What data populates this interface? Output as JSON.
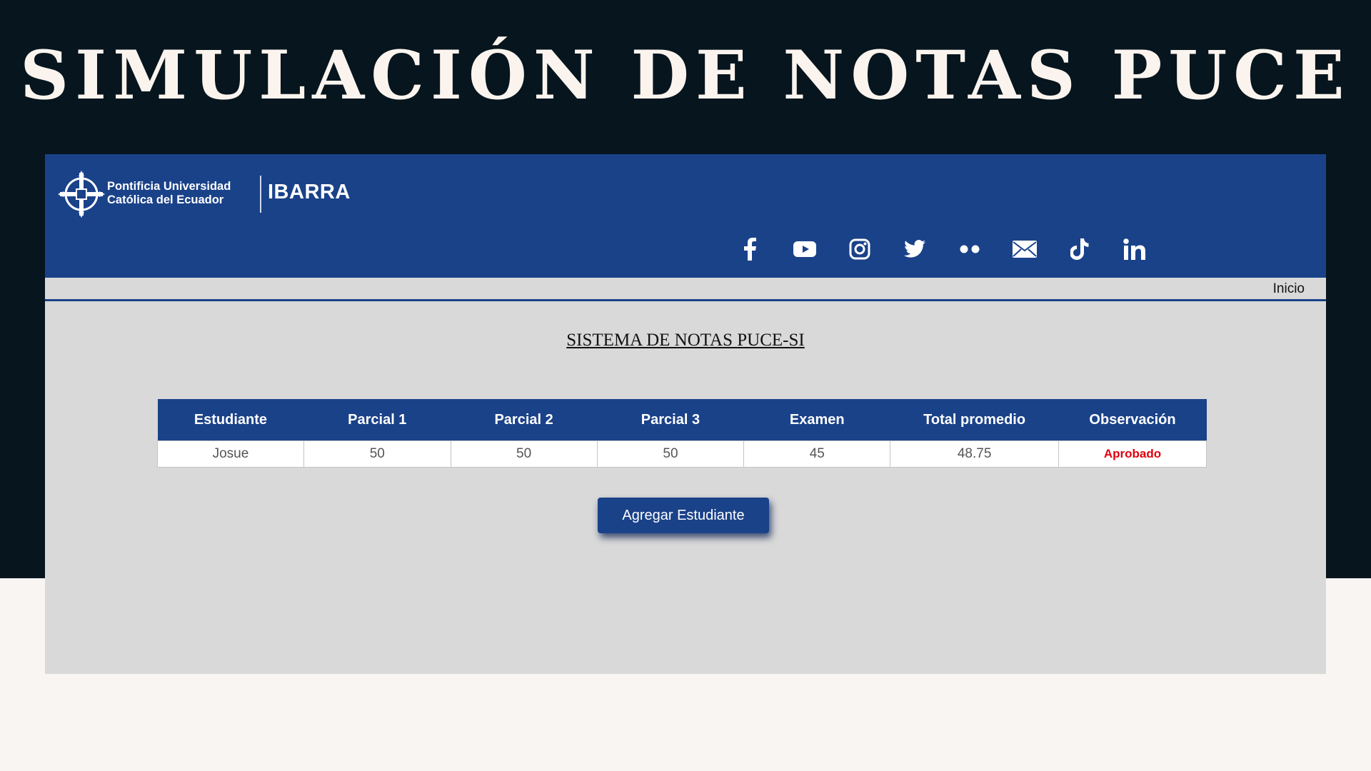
{
  "slide": {
    "title": "SIMULACIÓN DE NOTAS PUCE"
  },
  "header": {
    "logo": {
      "line1": "Pontificia Universidad",
      "line2": "Católica del Ecuador",
      "campus": "IBARRA"
    },
    "socials": [
      "facebook-icon",
      "youtube-icon",
      "instagram-icon",
      "twitter-icon",
      "flickr-icon",
      "mail-icon",
      "tiktok-icon",
      "linkedin-icon"
    ]
  },
  "nav": {
    "home": "Inicio"
  },
  "main": {
    "heading": "SISTEMA DE NOTAS PUCE-SI",
    "table": {
      "columns": [
        "Estudiante",
        "Parcial 1",
        "Parcial 2",
        "Parcial 3",
        "Examen",
        "Total promedio",
        "Observación"
      ],
      "rows": [
        [
          "Josue",
          "50",
          "50",
          "50",
          "45",
          "48.75",
          "Aprobado"
        ]
      ]
    },
    "add_button": "Agregar Estudiante"
  },
  "colors": {
    "brand_blue": "#1a4289",
    "approved_red": "#e0000e",
    "slide_dark": "#06151e"
  }
}
